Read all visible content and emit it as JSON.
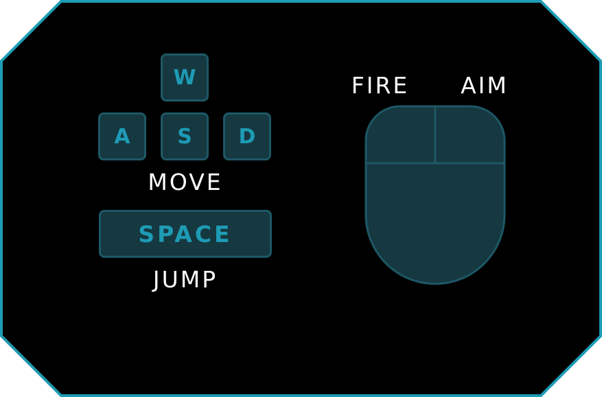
{
  "colors": {
    "background": "#000000",
    "border": "#1e9bb5",
    "key_fill": "#163840",
    "key_border": "#1d5866",
    "key_text": "#1e9bb5",
    "label_text": "#ffffff"
  },
  "keys": {
    "w": "W",
    "a": "A",
    "s": "S",
    "d": "D",
    "space": "SPACE"
  },
  "labels": {
    "move": "MOVE",
    "jump": "JUMP",
    "fire": "FIRE",
    "aim": "AIM"
  },
  "icons": {
    "mouse": "mouse-icon"
  }
}
